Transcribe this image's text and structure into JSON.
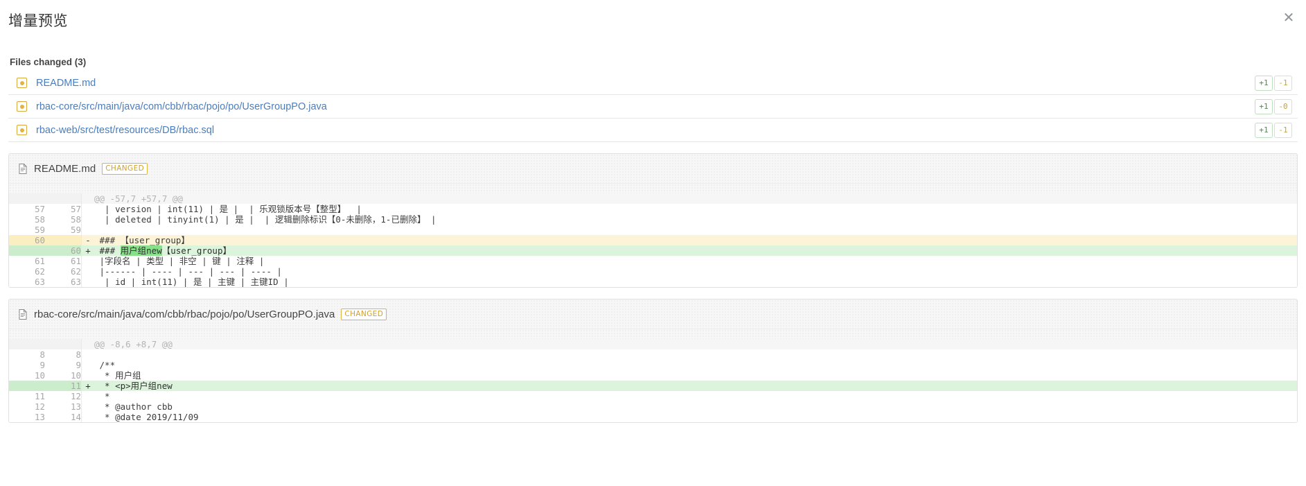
{
  "dialog": {
    "title": "增量预览",
    "close_icon": "close-icon",
    "close_label": "✕"
  },
  "files_changed": {
    "heading": "Files changed (3)",
    "rows": [
      {
        "icon": "modified-file-icon",
        "path": "README.md",
        "additions": "+1",
        "deletions": "-1"
      },
      {
        "icon": "modified-file-icon",
        "path": "rbac-core/src/main/java/com/cbb/rbac/pojo/po/UserGroupPO.java",
        "additions": "+1",
        "deletions": "-0"
      },
      {
        "icon": "modified-file-icon",
        "path": "rbac-web/src/test/resources/DB/rbac.sql",
        "additions": "+1",
        "deletions": "-1"
      }
    ]
  },
  "diffs": [
    {
      "filename": "README.md",
      "status_badge": "CHANGED",
      "icon": "document-icon",
      "hunk_header": "@@ -57,7 +57,7 @@",
      "lines": [
        {
          "old": "57",
          "new": "57",
          "marker": "",
          "type": "ctx",
          "code": "  | version | int(11) | 是 |  | 乐观锁版本号【整型】  |"
        },
        {
          "old": "58",
          "new": "58",
          "marker": "",
          "type": "ctx",
          "code": "  | deleted | tinyint(1) | 是 |  | 逻辑删除标识【0-未删除，1-已删除】 |"
        },
        {
          "old": "59",
          "new": "59",
          "marker": "",
          "type": "ctx",
          "code": ""
        },
        {
          "old": "60",
          "new": "",
          "marker": "-",
          "type": "del",
          "code": " ### 【user_group】"
        },
        {
          "old": "",
          "new": "60",
          "marker": "+",
          "type": "add",
          "code_pre": " ### ",
          "code_hl": "用户组new",
          "code_post": "【user_group】"
        },
        {
          "old": "61",
          "new": "61",
          "marker": "",
          "type": "ctx",
          "code": " |字段名 | 类型 | 非空 | 键 | 注释 |"
        },
        {
          "old": "62",
          "new": "62",
          "marker": "",
          "type": "ctx",
          "code": " |------ | ---- | --- | --- | ---- |"
        },
        {
          "old": "63",
          "new": "63",
          "marker": "",
          "type": "ctx",
          "code": "  | id | int(11) | 是 | 主键 | 主键ID |"
        }
      ]
    },
    {
      "filename": "rbac-core/src/main/java/com/cbb/rbac/pojo/po/UserGroupPO.java",
      "status_badge": "CHANGED",
      "icon": "document-icon",
      "hunk_header": "@@ -8,6 +8,7 @@",
      "lines": [
        {
          "old": "8",
          "new": "8",
          "marker": "",
          "type": "ctx",
          "code": ""
        },
        {
          "old": "9",
          "new": "9",
          "marker": "",
          "type": "ctx",
          "code": " /**"
        },
        {
          "old": "10",
          "new": "10",
          "marker": "",
          "type": "ctx",
          "code": "  * 用户组"
        },
        {
          "old": "",
          "new": "11",
          "marker": "+",
          "type": "add",
          "code_pre": "  * <p>用户组new",
          "code_hl": "",
          "code_post": ""
        },
        {
          "old": "11",
          "new": "12",
          "marker": "",
          "type": "ctx",
          "code": "  *"
        },
        {
          "old": "12",
          "new": "13",
          "marker": "",
          "type": "ctx",
          "code": "  * @author cbb"
        },
        {
          "old": "13",
          "new": "14",
          "marker": "",
          "type": "ctx",
          "code": "  * @date 2019/11/09"
        }
      ]
    }
  ],
  "colors": {
    "link": "#4a7dbd",
    "badge_border": "#dbb63f",
    "badge_text": "#d1a12a",
    "add_bg": "#dcf4dc",
    "del_bg": "#fdf3d7",
    "word_add_bg": "#88e08a",
    "add_count_text": "#4f8a4f",
    "del_count_text": "#c9a227"
  }
}
